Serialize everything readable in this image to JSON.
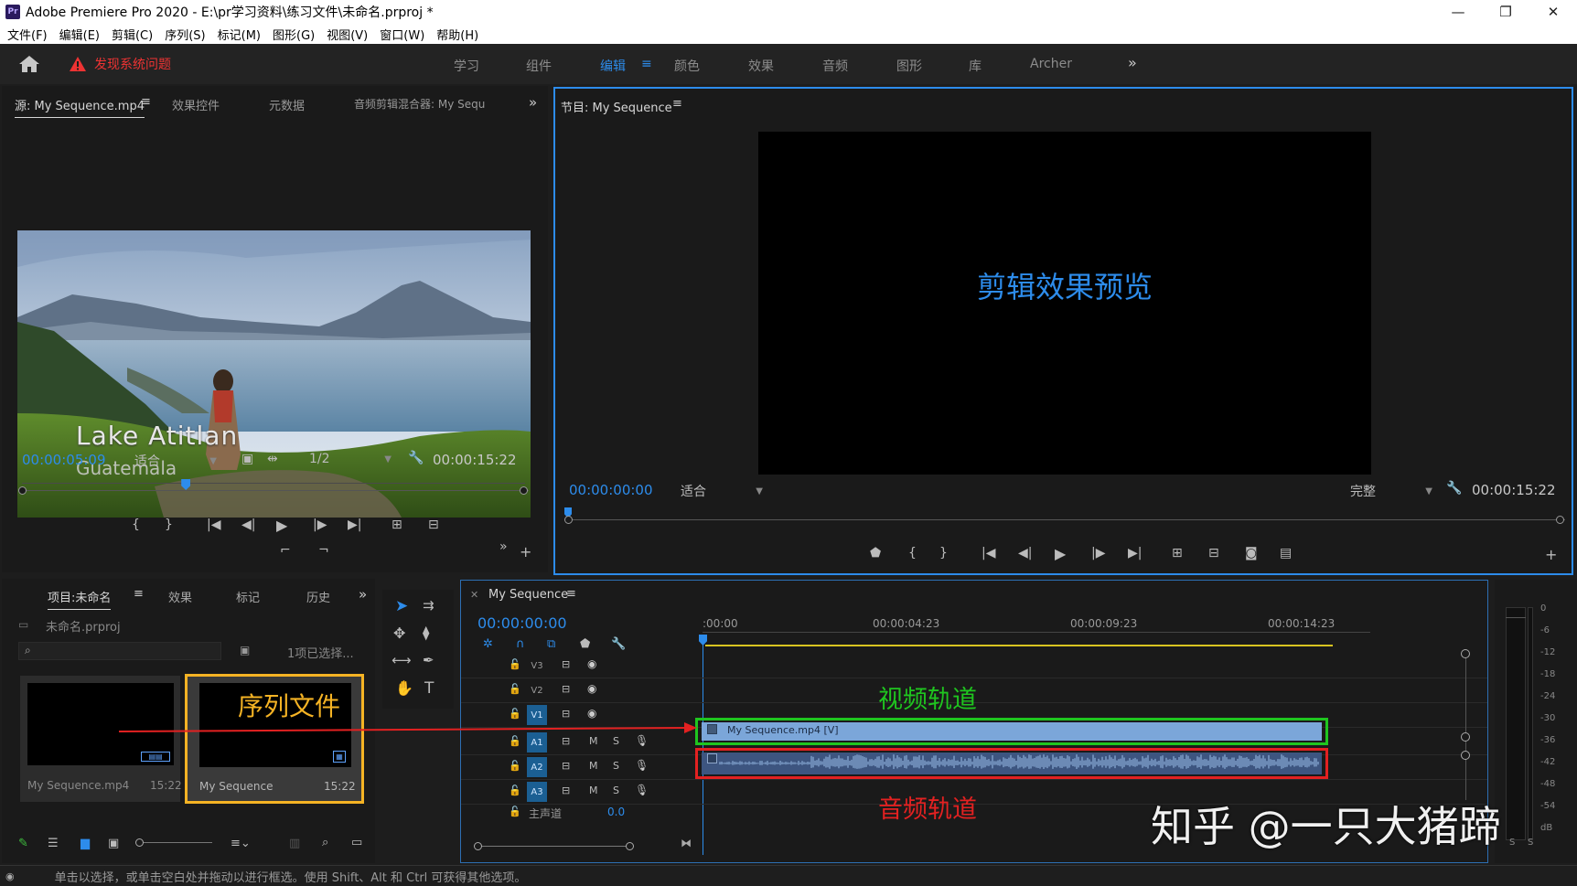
{
  "window": {
    "title": "Adobe Premiere Pro 2020 - E:\\pr学习资料\\练习文件\\未命名.prproj *",
    "logo_text": "Pr",
    "controls": [
      "—",
      "❐",
      "✕"
    ]
  },
  "menu": [
    "文件(F)",
    "编辑(E)",
    "剪辑(C)",
    "序列(S)",
    "标记(M)",
    "图形(G)",
    "视图(V)",
    "窗口(W)",
    "帮助(H)"
  ],
  "workspace": {
    "warning": "发现系统问题",
    "tabs": [
      "学习",
      "组件",
      "编辑",
      "颜色",
      "效果",
      "音频",
      "图形",
      "库",
      "Archer"
    ],
    "active_tab": "编辑",
    "more": "»"
  },
  "source_panel": {
    "tabs": [
      "源: My Sequence.mp4",
      "效果控件",
      "元数据",
      "音频剪辑混合器: My Sequ"
    ],
    "menu_glyph": "≡",
    "more": "»",
    "frame_title": "Lake Atitlan",
    "frame_subtitle": "Guatemala",
    "timecode": "00:00:05:09",
    "zoom": "适合",
    "resolution": "1/2",
    "duration": "00:00:15:22",
    "playhead_fraction": 0.33
  },
  "program_panel": {
    "title": "节目: My Sequence",
    "menu_glyph": "≡",
    "preview_label": "剪辑效果预览",
    "timecode": "00:00:00:00",
    "zoom": "适合",
    "quality": "完整",
    "duration": "00:00:15:22"
  },
  "project_panel": {
    "tabs": [
      "项目:未命名",
      "效果",
      "标记",
      "历史"
    ],
    "menu_glyph": "≡",
    "more": "»",
    "project_file": "未命名.prproj",
    "selection": "1项已选择...",
    "items": [
      {
        "name": "My Sequence.mp4",
        "duration": "15:22"
      },
      {
        "name": "My Sequence",
        "duration": "15:22"
      }
    ],
    "annotation": "序列文件"
  },
  "timeline": {
    "tab": "My Sequence",
    "menu_glyph": "≡",
    "timecode": "00:00:00:00",
    "ruler": [
      ":00:00",
      "00:00:04:23",
      "00:00:09:23",
      "00:00:14:23"
    ],
    "video_tracks": [
      "V3",
      "V2",
      "V1"
    ],
    "audio_tracks": [
      "A1",
      "A2",
      "A3"
    ],
    "master": "主声道",
    "master_value": "0.0",
    "video_clip": "My Sequence.mp4 [V]",
    "video_label": "视频轨道",
    "audio_label": "音频轨道",
    "track_ms": [
      "M",
      "S"
    ]
  },
  "meters": {
    "scale": [
      "0",
      "-6",
      "-12",
      "-18",
      "-24",
      "-30",
      "-36",
      "-42",
      "-48",
      "-54",
      "dB"
    ],
    "solo": [
      "S",
      "S"
    ]
  },
  "watermark": "知乎 @一只大猪蹄",
  "status_text": "单击以选择，或单击空白处并拖动以进行框选。使用 Shift、Alt 和 Ctrl 可获得其他选项。",
  "colors": {
    "accent": "#2d8ceb",
    "warning": "#e33333",
    "annotation_yellow": "#f5b324",
    "video_track_green": "#1fc51f",
    "audio_track_red": "#e32121",
    "clip_blue": "#7ba6d9",
    "audio_clip": "#3d5580"
  }
}
